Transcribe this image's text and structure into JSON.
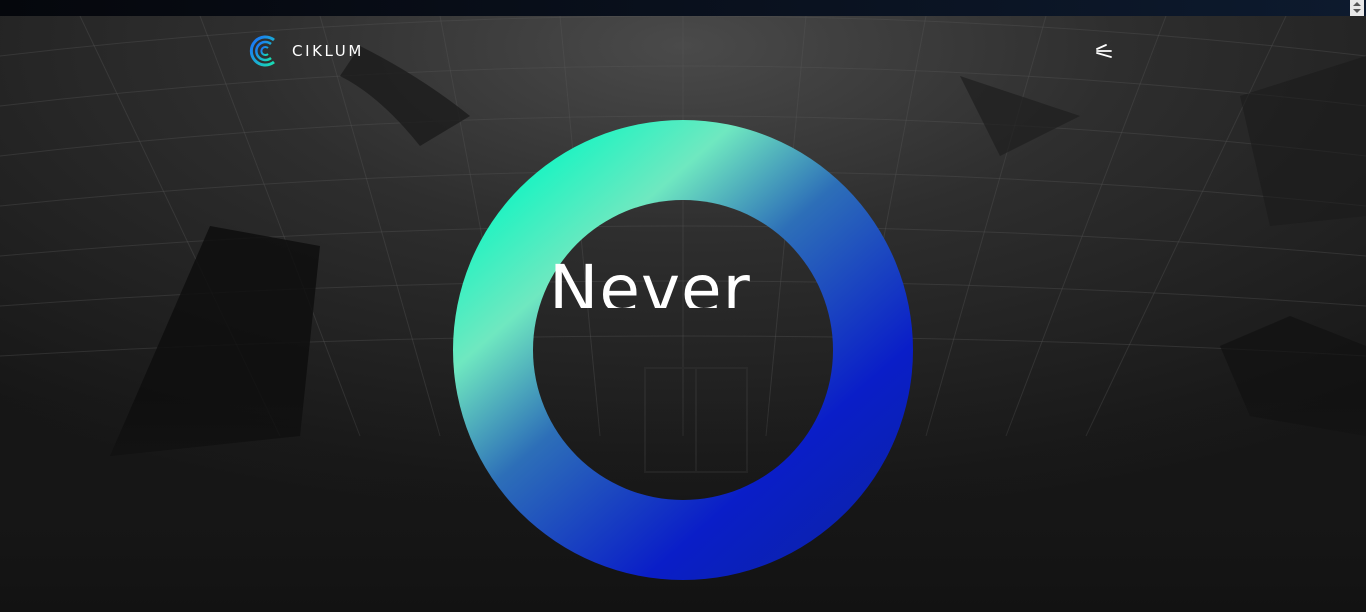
{
  "browser": {
    "scroll_control": "scroll-arrows-icon"
  },
  "header": {
    "logo_text": "CIKLUM",
    "logo_icon": "ciklum-logo-icon",
    "menu_icon": "menu-icon"
  },
  "hero": {
    "headline": "Never",
    "ring_colors": {
      "start": "#14f5c2",
      "mid": "#2d6fb8",
      "end": "#0a1ec8"
    },
    "background_color": "#141414"
  }
}
